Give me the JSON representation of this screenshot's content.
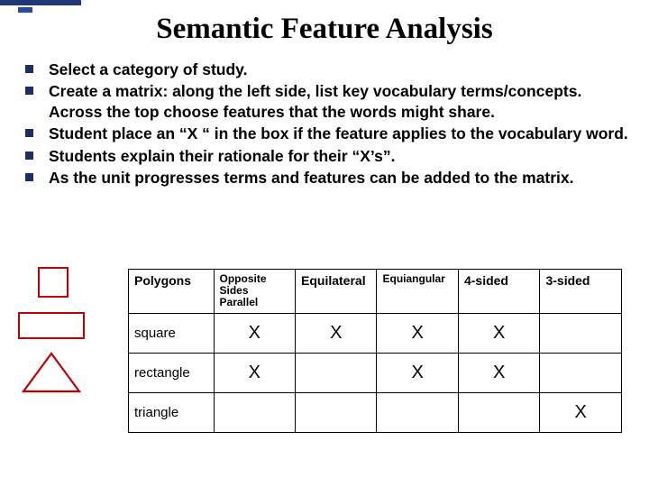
{
  "title": "Semantic Feature Analysis",
  "bullets": [
    "Select a category of study.",
    "Create a matrix: along the left side, list key vocabulary terms/concepts. Across the top choose features that the words might share.",
    "Student place an “X “ in the box if the feature applies to the vocabulary word.",
    "Students explain their rationale for their “X’s”.",
    "As the unit progresses terms and features can be added to the matrix."
  ],
  "chart_data": {
    "type": "table",
    "corner_label": "Polygons",
    "columns": [
      "Opposite Sides Parallel",
      "Equilateral",
      "Equiangular",
      "4-sided",
      "3-sided"
    ],
    "rows": [
      {
        "label": "square",
        "marks": [
          "X",
          "X",
          "X",
          "X",
          ""
        ]
      },
      {
        "label": "rectangle",
        "marks": [
          "X",
          "",
          "X",
          "X",
          ""
        ]
      },
      {
        "label": "triangle",
        "marks": [
          "",
          "",
          "",
          "",
          "X"
        ]
      }
    ]
  },
  "shapes": {
    "square_color": "#c00000",
    "rect_color": "#c00000",
    "triangle_color": "#c00000"
  }
}
